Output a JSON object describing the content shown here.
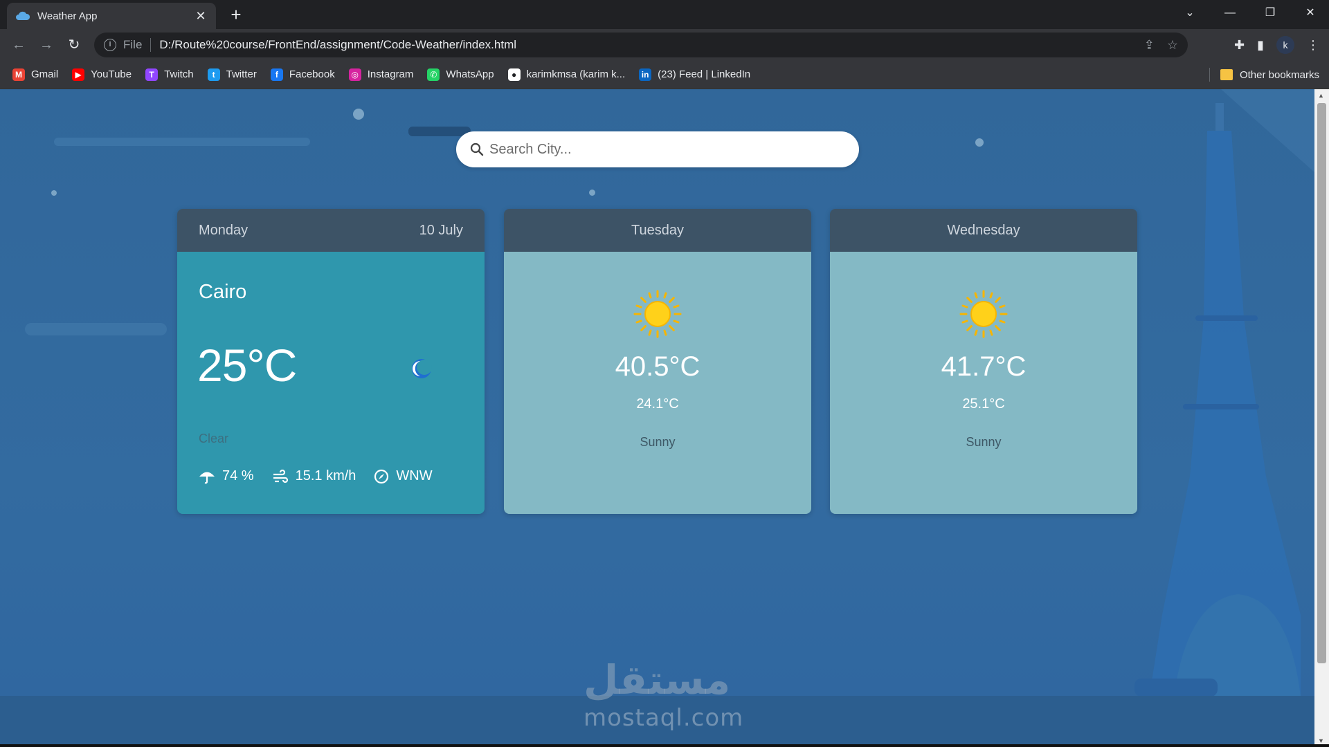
{
  "browser": {
    "tab_title": "Weather App",
    "scheme": "File",
    "url": "D:/Route%20course/FrontEnd/assignment/Code-Weather/index.html",
    "profile_initial": "k",
    "bookmarks": [
      {
        "label": "Gmail",
        "icon": "gmail-icon",
        "color": "#ea4335",
        "glyph": "M"
      },
      {
        "label": "YouTube",
        "icon": "youtube-icon",
        "color": "#ff0000",
        "glyph": "▶"
      },
      {
        "label": "Twitch",
        "icon": "twitch-icon",
        "color": "#9146ff",
        "glyph": "T"
      },
      {
        "label": "Twitter",
        "icon": "twitter-icon",
        "color": "#1d9bf0",
        "glyph": "t"
      },
      {
        "label": "Facebook",
        "icon": "facebook-icon",
        "color": "#1877f2",
        "glyph": "f"
      },
      {
        "label": "Instagram",
        "icon": "instagram-icon",
        "color": "#d6249f",
        "glyph": "◎"
      },
      {
        "label": "WhatsApp",
        "icon": "whatsapp-icon",
        "color": "#25d366",
        "glyph": "✆"
      },
      {
        "label": "karimkmsa (karim k...",
        "icon": "github-icon",
        "color": "#ffffff",
        "glyph": "●"
      },
      {
        "label": "(23) Feed | LinkedIn",
        "icon": "linkedin-icon",
        "color": "#0a66c2",
        "glyph": "in"
      }
    ],
    "other_bookmarks": "Other bookmarks"
  },
  "search": {
    "placeholder": "Search City..."
  },
  "today": {
    "day": "Monday",
    "date": "10 July",
    "city": "Cairo",
    "temp": "25°C",
    "condition": "Clear",
    "humidity": "74 %",
    "wind_speed": "15.1 km/h",
    "wind_dir": "WNW",
    "icon": "moon-icon"
  },
  "forecast": [
    {
      "day": "Tuesday",
      "max": "40.5°C",
      "min": "24.1°C",
      "condition": "Sunny",
      "icon": "sun-icon"
    },
    {
      "day": "Wednesday",
      "max": "41.7°C",
      "min": "25.1°C",
      "condition": "Sunny",
      "icon": "sun-icon"
    }
  ],
  "watermark": {
    "arabic": "مستقل",
    "latin": "mostaql.com"
  },
  "colors": {
    "today_card": "#2f97ad",
    "forecast_card": "#84b9c5",
    "card_header": "#3d5366",
    "page_bg": "#31679a"
  }
}
